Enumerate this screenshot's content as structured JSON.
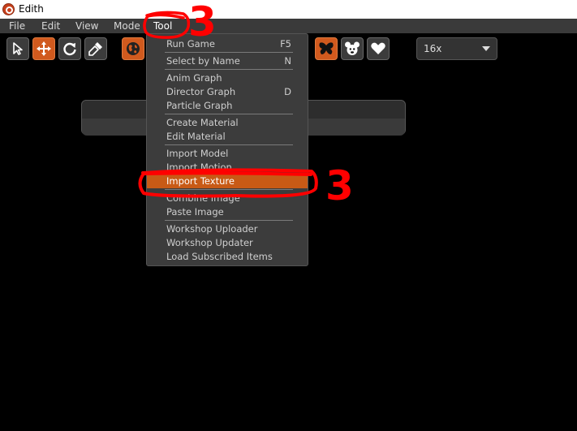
{
  "window": {
    "title": "Edith"
  },
  "menubar": {
    "items": [
      {
        "label": "File"
      },
      {
        "label": "Edit"
      },
      {
        "label": "View"
      },
      {
        "label": "Mode"
      },
      {
        "label": "Tool"
      }
    ]
  },
  "toolbar": {
    "buttons": [
      {
        "icon": "select-arrow-icon"
      },
      {
        "icon": "move-arrows-icon"
      },
      {
        "icon": "rotate-icon"
      },
      {
        "icon": "brush-icon"
      },
      {
        "icon": "globe-icon"
      },
      {
        "icon": "butterfly-icon"
      },
      {
        "icon": "mouse-face-icon"
      },
      {
        "icon": "heart-icon"
      }
    ],
    "zoom": {
      "value": "16x"
    }
  },
  "tool_menu": {
    "items": [
      {
        "label": "Run Game",
        "shortcut": "F5"
      },
      {
        "label": "Select by Name",
        "shortcut": "N"
      },
      {
        "label": "Anim Graph",
        "shortcut": ""
      },
      {
        "label": "Director Graph",
        "shortcut": "D"
      },
      {
        "label": "Particle Graph",
        "shortcut": ""
      },
      {
        "label": "Create Material",
        "shortcut": ""
      },
      {
        "label": "Edit Material",
        "shortcut": ""
      },
      {
        "label": "Import Model",
        "shortcut": ""
      },
      {
        "label": "Import Motion",
        "shortcut": ""
      },
      {
        "label": "Import Texture",
        "shortcut": ""
      },
      {
        "label": "Combine Image",
        "shortcut": ""
      },
      {
        "label": "Paste Image",
        "shortcut": ""
      },
      {
        "label": "Workshop Uploader",
        "shortcut": ""
      },
      {
        "label": "Workshop Updater",
        "shortcut": ""
      },
      {
        "label": "Load Subscribed Items",
        "shortcut": ""
      }
    ]
  },
  "annotations": {
    "step_top": "3",
    "step_item": "3"
  },
  "colors": {
    "accent": "#d15a1e",
    "annotation": "#ff0000",
    "menubar": "#3a3a3a"
  }
}
